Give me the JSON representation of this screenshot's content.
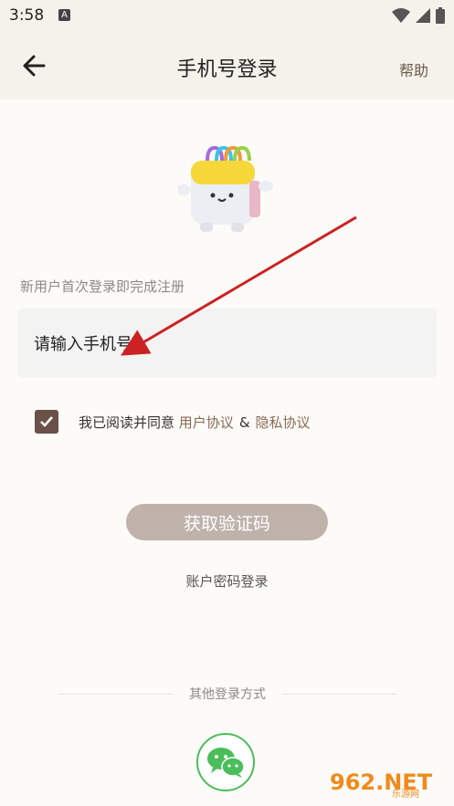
{
  "status": {
    "time": "3:58",
    "notif": "A"
  },
  "header": {
    "title": "手机号登录",
    "help": "帮助"
  },
  "form": {
    "hint": "新用户首次登录即完成注册",
    "phone_placeholder": "请输入手机号",
    "agree_prefix": "我已阅读并同意",
    "user_agreement": "用户协议",
    "amp": "&",
    "privacy": "隐私协议",
    "agreed": true
  },
  "actions": {
    "get_code": "获取验证码",
    "password_login": "账户密码登录"
  },
  "other": {
    "label": "其他登录方式",
    "wechat": "wechat-icon"
  },
  "watermark": {
    "text": "962.NET",
    "sub": "乐游网"
  },
  "colors": {
    "accent": "#6b5149",
    "button": "#bfb2aa",
    "link": "#8a6a55",
    "wechat": "#4bbd5a",
    "header_bg": "#f5f2ec"
  }
}
